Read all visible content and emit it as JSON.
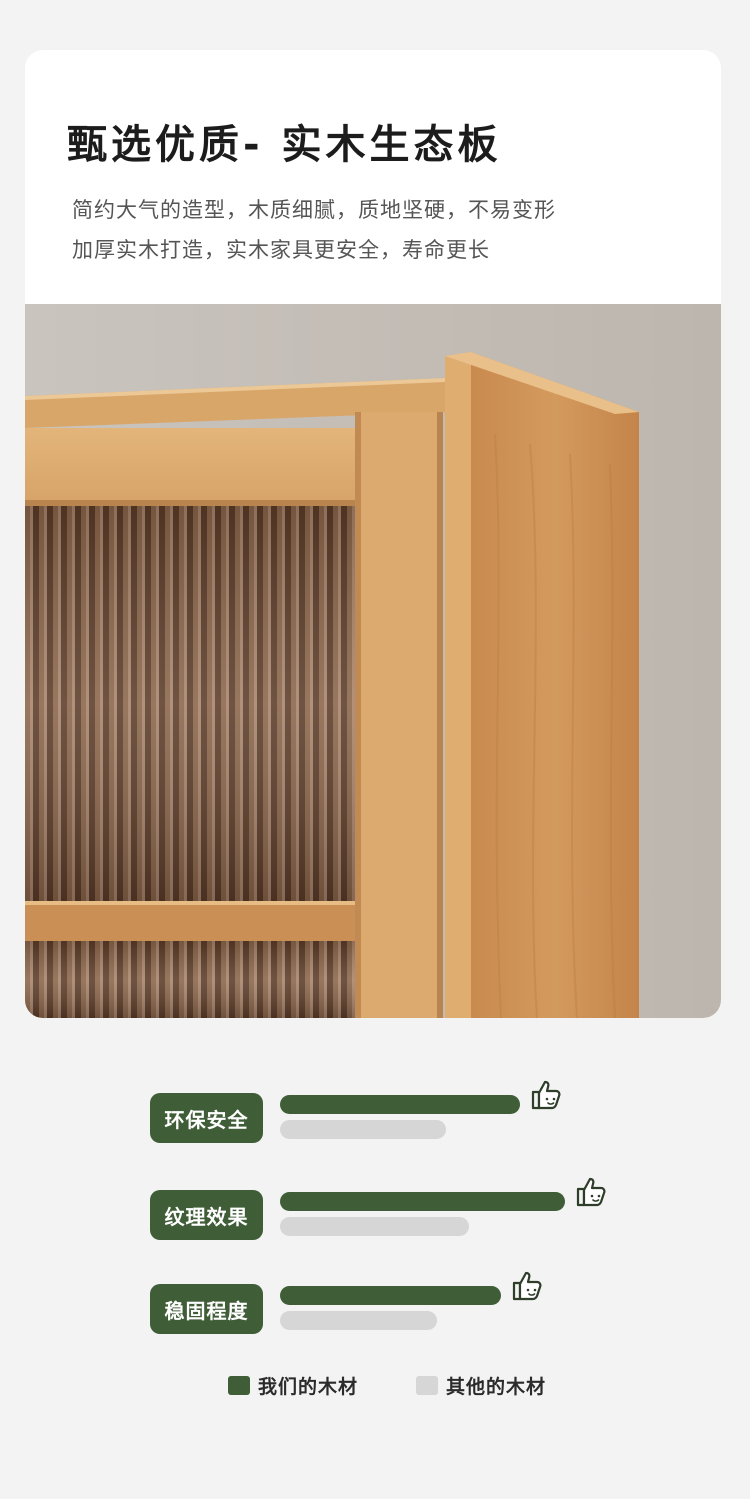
{
  "header": {
    "title": "甄选优质- 实木生态板",
    "desc_line1": "简约大气的造型，木质细腻，质地坚硬，不易变形",
    "desc_line2": "加厚实木打造，实木家具更安全，寿命更长"
  },
  "photo": {
    "subject-icon": "wooden-cabinet-photo"
  },
  "colors": {
    "ours": "#3f5d37",
    "other": "#d6d6d6"
  },
  "comparison": [
    {
      "label": "环保安全",
      "ours": 0.75,
      "other": 0.52
    },
    {
      "label": "纹理效果",
      "ours": 0.89,
      "other": 0.59
    },
    {
      "label": "稳固程度",
      "ours": 0.69,
      "other": 0.49
    }
  ],
  "legend": {
    "ours_label": "我们的木材",
    "other_label": "其他的木材"
  },
  "icons": {
    "comparison": "thumbs-up-icon"
  }
}
